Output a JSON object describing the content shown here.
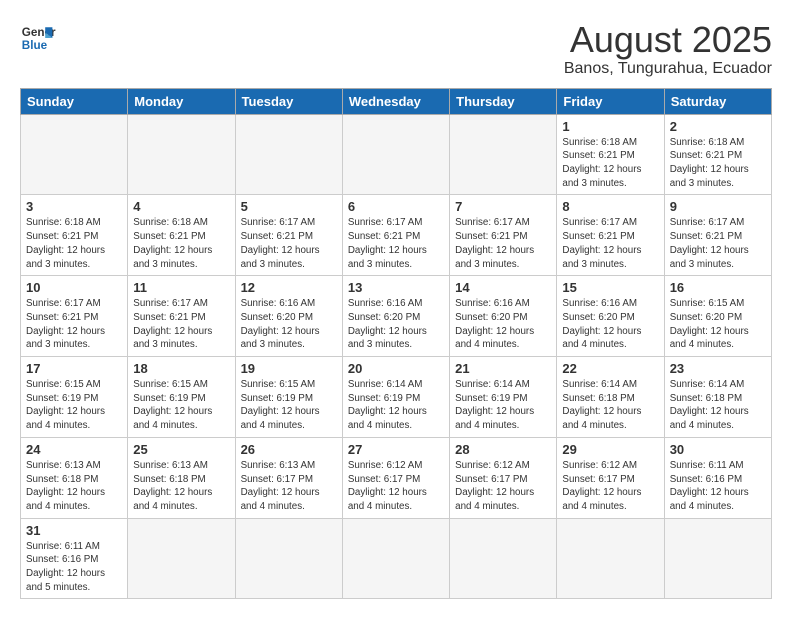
{
  "header": {
    "logo": {
      "general": "General",
      "blue": "Blue"
    },
    "title": "August 2025",
    "subtitle": "Banos, Tungurahua, Ecuador"
  },
  "weekdays": [
    "Sunday",
    "Monday",
    "Tuesday",
    "Wednesday",
    "Thursday",
    "Friday",
    "Saturday"
  ],
  "weeks": [
    [
      {
        "day": "",
        "info": "",
        "empty": true
      },
      {
        "day": "",
        "info": "",
        "empty": true
      },
      {
        "day": "",
        "info": "",
        "empty": true
      },
      {
        "day": "",
        "info": "",
        "empty": true
      },
      {
        "day": "",
        "info": "",
        "empty": true
      },
      {
        "day": "1",
        "info": "Sunrise: 6:18 AM\nSunset: 6:21 PM\nDaylight: 12 hours and 3 minutes."
      },
      {
        "day": "2",
        "info": "Sunrise: 6:18 AM\nSunset: 6:21 PM\nDaylight: 12 hours and 3 minutes."
      }
    ],
    [
      {
        "day": "3",
        "info": "Sunrise: 6:18 AM\nSunset: 6:21 PM\nDaylight: 12 hours and 3 minutes."
      },
      {
        "day": "4",
        "info": "Sunrise: 6:18 AM\nSunset: 6:21 PM\nDaylight: 12 hours and 3 minutes."
      },
      {
        "day": "5",
        "info": "Sunrise: 6:17 AM\nSunset: 6:21 PM\nDaylight: 12 hours and 3 minutes."
      },
      {
        "day": "6",
        "info": "Sunrise: 6:17 AM\nSunset: 6:21 PM\nDaylight: 12 hours and 3 minutes."
      },
      {
        "day": "7",
        "info": "Sunrise: 6:17 AM\nSunset: 6:21 PM\nDaylight: 12 hours and 3 minutes."
      },
      {
        "day": "8",
        "info": "Sunrise: 6:17 AM\nSunset: 6:21 PM\nDaylight: 12 hours and 3 minutes."
      },
      {
        "day": "9",
        "info": "Sunrise: 6:17 AM\nSunset: 6:21 PM\nDaylight: 12 hours and 3 minutes."
      }
    ],
    [
      {
        "day": "10",
        "info": "Sunrise: 6:17 AM\nSunset: 6:21 PM\nDaylight: 12 hours and 3 minutes."
      },
      {
        "day": "11",
        "info": "Sunrise: 6:17 AM\nSunset: 6:21 PM\nDaylight: 12 hours and 3 minutes."
      },
      {
        "day": "12",
        "info": "Sunrise: 6:16 AM\nSunset: 6:20 PM\nDaylight: 12 hours and 3 minutes."
      },
      {
        "day": "13",
        "info": "Sunrise: 6:16 AM\nSunset: 6:20 PM\nDaylight: 12 hours and 3 minutes."
      },
      {
        "day": "14",
        "info": "Sunrise: 6:16 AM\nSunset: 6:20 PM\nDaylight: 12 hours and 4 minutes."
      },
      {
        "day": "15",
        "info": "Sunrise: 6:16 AM\nSunset: 6:20 PM\nDaylight: 12 hours and 4 minutes."
      },
      {
        "day": "16",
        "info": "Sunrise: 6:15 AM\nSunset: 6:20 PM\nDaylight: 12 hours and 4 minutes."
      }
    ],
    [
      {
        "day": "17",
        "info": "Sunrise: 6:15 AM\nSunset: 6:19 PM\nDaylight: 12 hours and 4 minutes."
      },
      {
        "day": "18",
        "info": "Sunrise: 6:15 AM\nSunset: 6:19 PM\nDaylight: 12 hours and 4 minutes."
      },
      {
        "day": "19",
        "info": "Sunrise: 6:15 AM\nSunset: 6:19 PM\nDaylight: 12 hours and 4 minutes."
      },
      {
        "day": "20",
        "info": "Sunrise: 6:14 AM\nSunset: 6:19 PM\nDaylight: 12 hours and 4 minutes."
      },
      {
        "day": "21",
        "info": "Sunrise: 6:14 AM\nSunset: 6:19 PM\nDaylight: 12 hours and 4 minutes."
      },
      {
        "day": "22",
        "info": "Sunrise: 6:14 AM\nSunset: 6:18 PM\nDaylight: 12 hours and 4 minutes."
      },
      {
        "day": "23",
        "info": "Sunrise: 6:14 AM\nSunset: 6:18 PM\nDaylight: 12 hours and 4 minutes."
      }
    ],
    [
      {
        "day": "24",
        "info": "Sunrise: 6:13 AM\nSunset: 6:18 PM\nDaylight: 12 hours and 4 minutes."
      },
      {
        "day": "25",
        "info": "Sunrise: 6:13 AM\nSunset: 6:18 PM\nDaylight: 12 hours and 4 minutes."
      },
      {
        "day": "26",
        "info": "Sunrise: 6:13 AM\nSunset: 6:17 PM\nDaylight: 12 hours and 4 minutes."
      },
      {
        "day": "27",
        "info": "Sunrise: 6:12 AM\nSunset: 6:17 PM\nDaylight: 12 hours and 4 minutes."
      },
      {
        "day": "28",
        "info": "Sunrise: 6:12 AM\nSunset: 6:17 PM\nDaylight: 12 hours and 4 minutes."
      },
      {
        "day": "29",
        "info": "Sunrise: 6:12 AM\nSunset: 6:17 PM\nDaylight: 12 hours and 4 minutes."
      },
      {
        "day": "30",
        "info": "Sunrise: 6:11 AM\nSunset: 6:16 PM\nDaylight: 12 hours and 4 minutes."
      }
    ],
    [
      {
        "day": "31",
        "info": "Sunrise: 6:11 AM\nSunset: 6:16 PM\nDaylight: 12 hours and 5 minutes."
      },
      {
        "day": "",
        "info": "",
        "empty": true
      },
      {
        "day": "",
        "info": "",
        "empty": true
      },
      {
        "day": "",
        "info": "",
        "empty": true
      },
      {
        "day": "",
        "info": "",
        "empty": true
      },
      {
        "day": "",
        "info": "",
        "empty": true
      },
      {
        "day": "",
        "info": "",
        "empty": true
      }
    ]
  ]
}
